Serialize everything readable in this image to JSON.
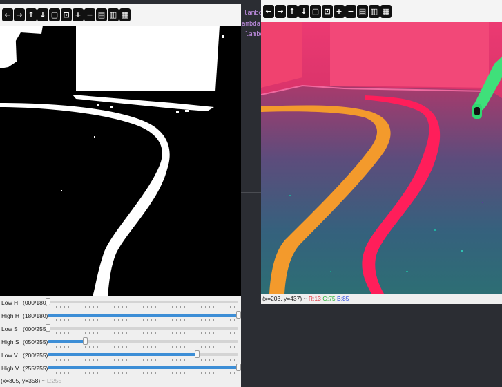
{
  "left_window": {
    "toolbar": [
      {
        "icon": "arrow-left-icon",
        "glyph": "←"
      },
      {
        "icon": "arrow-right-icon",
        "glyph": "→"
      },
      {
        "icon": "arrow-up-icon",
        "glyph": "↑"
      },
      {
        "icon": "arrow-down-icon",
        "glyph": "↓"
      },
      {
        "icon": "zoom-fit-icon",
        "glyph": "▢"
      },
      {
        "icon": "zoom-original-icon",
        "glyph": "⊡"
      },
      {
        "icon": "zoom-in-icon",
        "glyph": "+"
      },
      {
        "icon": "zoom-out-icon",
        "glyph": "−"
      },
      {
        "icon": "save-icon",
        "glyph": "▤"
      },
      {
        "icon": "copy-icon",
        "glyph": "▥"
      },
      {
        "icon": "properties-icon",
        "glyph": "▦"
      }
    ],
    "trackbars": [
      {
        "name": "Low H",
        "value_label": "(000/180)",
        "fraction": 0.0
      },
      {
        "name": "High H",
        "value_label": "(180/180)",
        "fraction": 1.0
      },
      {
        "name": "Low S",
        "value_label": "(000/255)",
        "fraction": 0.0
      },
      {
        "name": "High S",
        "value_label": "(050/255)",
        "fraction": 0.196
      },
      {
        "name": "Low V",
        "value_label": "(200/255)",
        "fraction": 0.784
      },
      {
        "name": "High V",
        "value_label": "(255/255)",
        "fraction": 1.0
      }
    ],
    "status": {
      "coords": "(x=305, y=358) ~ ",
      "value": "L:255"
    }
  },
  "code_strip": {
    "lines": [
      "lambd",
      "ambda",
      "lambd"
    ]
  },
  "right_window": {
    "toolbar": [
      {
        "icon": "arrow-left-icon",
        "glyph": "←"
      },
      {
        "icon": "arrow-right-icon",
        "glyph": "→"
      },
      {
        "icon": "arrow-up-icon",
        "glyph": "↑"
      },
      {
        "icon": "arrow-down-icon",
        "glyph": "↓"
      },
      {
        "icon": "zoom-fit-icon",
        "glyph": "▢"
      },
      {
        "icon": "zoom-original-icon",
        "glyph": "⊡"
      },
      {
        "icon": "zoom-in-icon",
        "glyph": "+"
      },
      {
        "icon": "zoom-out-icon",
        "glyph": "−"
      },
      {
        "icon": "save-icon",
        "glyph": "▤"
      },
      {
        "icon": "copy-icon",
        "glyph": "▥"
      },
      {
        "icon": "properties-icon",
        "glyph": "▦"
      }
    ],
    "status": {
      "coords": "(x=203, y=437) ~ ",
      "r": "R:13",
      "g": "G:75",
      "b": "B:85"
    }
  },
  "colors": {
    "trackbar_fill": "#3d8ed6",
    "status_r": "#e0303a",
    "status_g": "#25b030",
    "status_b": "#2244dd",
    "status_l": "#aaaaaa",
    "tape_orange": "#f39a2c",
    "tape_red": "#ff1e5a",
    "code_text": "#c792ea"
  }
}
